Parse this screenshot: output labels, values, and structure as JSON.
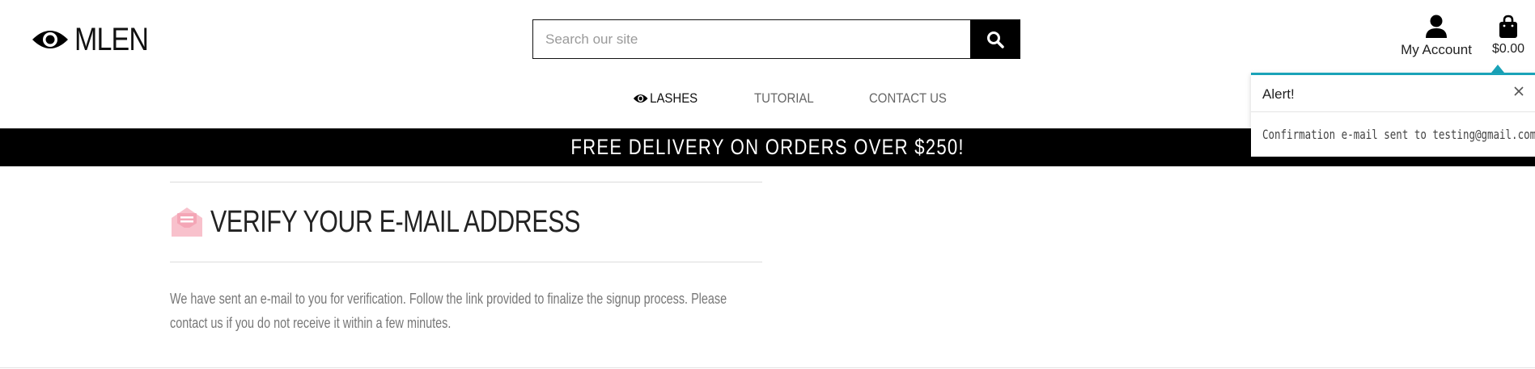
{
  "header": {
    "logo_text": "MLEN",
    "search": {
      "placeholder": "Search our site",
      "value": ""
    },
    "account_label": "My Account",
    "cart_total": "$0.00"
  },
  "nav": {
    "items": [
      {
        "label": "LASHES",
        "icon": "eye-icon",
        "active": true
      },
      {
        "label": "TUTORIAL",
        "active": false
      },
      {
        "label": "CONTACT US",
        "active": false
      }
    ]
  },
  "banner": {
    "text": "FREE DELIVERY ON ORDERS OVER $250!"
  },
  "alert": {
    "title": "Alert!",
    "message": "Confirmation e-mail sent to testing@gmail.com.",
    "accent_color": "#1aa3b8"
  },
  "main": {
    "title": "VERIFY YOUR E-MAIL ADDRESS",
    "icon": "mail-open-icon",
    "icon_color": "#f8c1cc",
    "message": "We have sent an e-mail to you for verification. Follow the link provided to finalize the signup process. Please contact us if you do not receive it within a few minutes."
  }
}
